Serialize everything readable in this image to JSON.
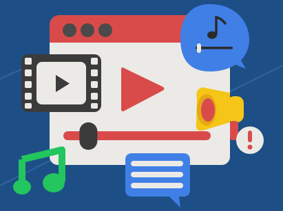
{
  "scene": {
    "subject": "video-player-illustration",
    "background_color": "#1d4f86",
    "window": {
      "frame_color": "#d94b4b",
      "body_color": "#eceae6",
      "traffic_lights": [
        "window-dot-1",
        "window-dot-2",
        "window-dot-3"
      ],
      "traffic_light_color": "#4a4a4a"
    },
    "icons": {
      "music-bubble": "music-note-icon",
      "film-strip": "film-play-icon",
      "megaphone": "megaphone-icon",
      "alert": "exclamation-icon",
      "chat": "chat-lines-icon",
      "music-note": "music-note-icon"
    },
    "colors": {
      "accent_red": "#d94b4b",
      "bubble_blue": "#3f7fe6",
      "note_green": "#22c55e",
      "megaphone_yellow": "#f5c518",
      "dark": "#3b3b3b"
    },
    "player": {
      "progress_fraction": 0.17
    }
  }
}
